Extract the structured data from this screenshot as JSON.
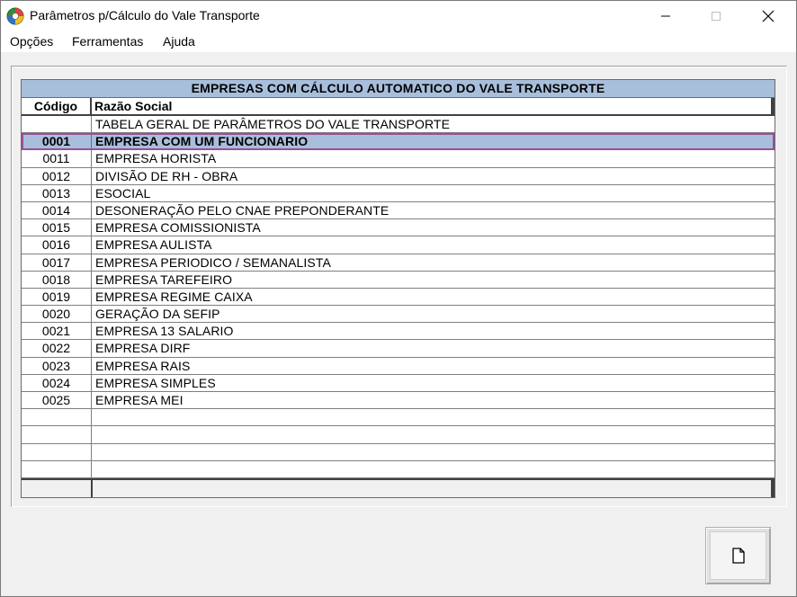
{
  "window": {
    "title": "Parâmetros p/Cálculo do Vale Transporte",
    "icon": "app-globe-icon"
  },
  "menu": {
    "items": [
      {
        "label": "Opções"
      },
      {
        "label": "Ferramentas"
      },
      {
        "label": "Ajuda"
      }
    ]
  },
  "grid": {
    "caption": "EMPRESAS COM CÁLCULO AUTOMATICO DO VALE TRANSPORTE",
    "columns": {
      "code": "Código",
      "name": "Razão Social"
    },
    "selected_code": "0001",
    "rows": [
      {
        "code": "",
        "name": "TABELA GERAL DE PARÂMETROS DO VALE TRANSPORTE"
      },
      {
        "code": "0001",
        "name": "EMPRESA COM UM FUNCIONARIO"
      },
      {
        "code": "0011",
        "name": "EMPRESA HORISTA"
      },
      {
        "code": "0012",
        "name": "DIVISÃO DE RH - OBRA"
      },
      {
        "code": "0013",
        "name": "ESOCIAL"
      },
      {
        "code": "0014",
        "name": "DESONERAÇÃO PELO CNAE PREPONDERANTE"
      },
      {
        "code": "0015",
        "name": "EMPRESA COMISSIONISTA"
      },
      {
        "code": "0016",
        "name": "EMPRESA AULISTA"
      },
      {
        "code": "0017",
        "name": "EMPRESA PERIODICO / SEMANALISTA"
      },
      {
        "code": "0018",
        "name": "EMPRESA TAREFEIRO"
      },
      {
        "code": "0019",
        "name": "EMPRESA REGIME CAIXA"
      },
      {
        "code": "0020",
        "name": "GERAÇÃO DA SEFIP"
      },
      {
        "code": "0021",
        "name": "EMPRESA 13 SALARIO"
      },
      {
        "code": "0022",
        "name": "EMPRESA DIRF"
      },
      {
        "code": "0023",
        "name": "EMPRESA RAIS"
      },
      {
        "code": "0024",
        "name": "EMPRESA SIMPLES"
      },
      {
        "code": "0025",
        "name": "EMPRESA MEI"
      },
      {
        "code": "",
        "name": ""
      },
      {
        "code": "",
        "name": ""
      },
      {
        "code": "",
        "name": ""
      },
      {
        "code": "",
        "name": ""
      }
    ]
  },
  "actions": {
    "new_icon": "new-document-icon"
  },
  "colors": {
    "caption_bg": "#a8bfdc",
    "selection_bg": "#a8bfdc",
    "selection_border": "#9b4f9b",
    "window_bg": "#f0f0f0"
  }
}
